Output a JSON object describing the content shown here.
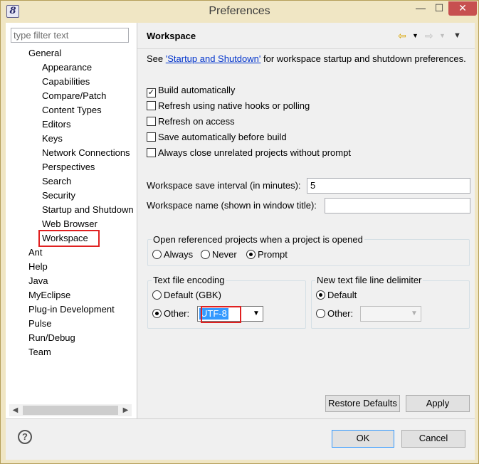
{
  "window": {
    "title": "Preferences",
    "icon": "eclipse-logo-icon",
    "minimize": "—",
    "maximize": "☐",
    "close": "✕"
  },
  "filter": {
    "placeholder": "type filter text"
  },
  "tree": {
    "items": [
      {
        "label": "General"
      },
      {
        "label": "Appearance"
      },
      {
        "label": "Capabilities"
      },
      {
        "label": "Compare/Patch"
      },
      {
        "label": "Content Types"
      },
      {
        "label": "Editors"
      },
      {
        "label": "Keys"
      },
      {
        "label": "Network Connections"
      },
      {
        "label": "Perspectives"
      },
      {
        "label": "Search"
      },
      {
        "label": "Security"
      },
      {
        "label": "Startup and Shutdown"
      },
      {
        "label": "Web Browser"
      },
      {
        "label": "Workspace"
      },
      {
        "label": "Ant"
      },
      {
        "label": "Help"
      },
      {
        "label": "Java"
      },
      {
        "label": "MyEclipse"
      },
      {
        "label": "Plug-in Development"
      },
      {
        "label": "Pulse"
      },
      {
        "label": "Run/Debug"
      },
      {
        "label": "Team"
      }
    ],
    "selected": "Workspace"
  },
  "page": {
    "title": "Workspace",
    "intro_prefix": "See ",
    "intro_link": "'Startup and Shutdown'",
    "intro_suffix": " for workspace startup and shutdown preferences.",
    "checks": [
      {
        "label": "Build automatically",
        "checked": true
      },
      {
        "label": "Refresh using native hooks or polling",
        "checked": false
      },
      {
        "label": "Refresh on access",
        "checked": false
      },
      {
        "label": "Save automatically before build",
        "checked": false
      },
      {
        "label": "Always close unrelated projects without prompt",
        "checked": false
      }
    ],
    "save_interval_label": "Workspace save interval (in minutes):",
    "save_interval_value": "5",
    "workspace_name_label": "Workspace name (shown in window title):",
    "workspace_name_value": "",
    "open_projects": {
      "title": "Open referenced projects when a project is opened",
      "options": [
        "Always",
        "Never",
        "Prompt"
      ],
      "selected": "Prompt"
    },
    "encoding": {
      "title": "Text file encoding",
      "default_label": "Default (GBK)",
      "other_label": "Other:",
      "selected": "Other",
      "other_value": "UTF-8"
    },
    "delimiter": {
      "title": "New text file line delimiter",
      "default_label": "Default",
      "other_label": "Other:",
      "selected": "Default",
      "other_value": ""
    },
    "restore_defaults": "Restore Defaults",
    "apply": "Apply"
  },
  "footer": {
    "ok": "OK",
    "cancel": "Cancel",
    "help": "?"
  },
  "colors": {
    "title_bar": "#f0e6c4",
    "close_button": "#c75050",
    "highlight_outline": "#e02020",
    "link": "#0033cc",
    "selection": "#3399ff"
  }
}
